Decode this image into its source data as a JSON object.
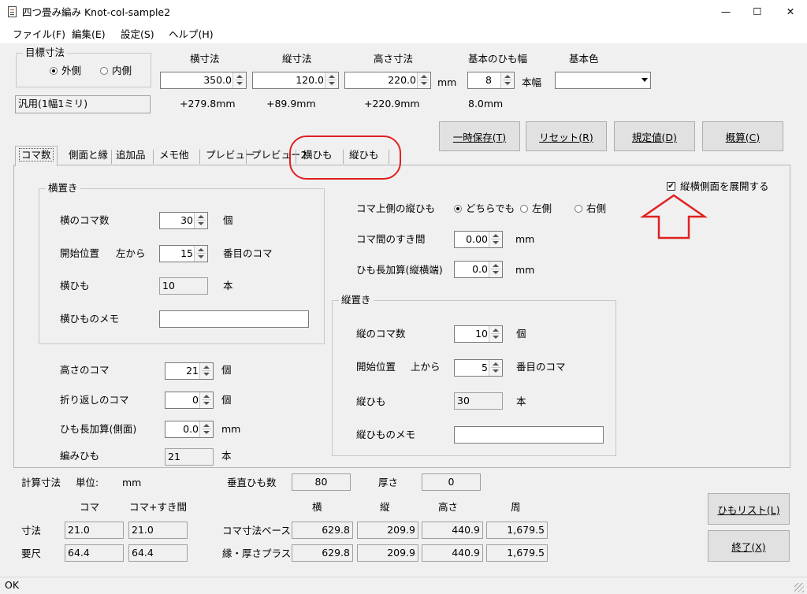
{
  "window": {
    "title": "四つ畳み編み Knot-col-sample2",
    "minimize": "—",
    "maximize": "☐",
    "close": "✕"
  },
  "menu": [
    {
      "label": "ファイル(F)"
    },
    {
      "label": "編集(E)"
    },
    {
      "label": "設定(S)"
    },
    {
      "label": "ヘルプ(H)"
    }
  ],
  "target": {
    "group_title": "目標寸法",
    "outer": "外側",
    "inner": "内側",
    "width_label": "横寸法",
    "depth_label": "縦寸法",
    "height_label": "高さ寸法",
    "band_label": "基本のひも幅",
    "color_label": "基本色",
    "width_value": "350.0",
    "depth_value": "120.0",
    "height_value": "220.0",
    "mm": "mm",
    "band_value": "8",
    "band_unit": "本幅",
    "color_value": "",
    "calc_width": "+279.8mm",
    "calc_depth": "+89.9mm",
    "calc_height": "+220.9mm",
    "calc_band": "8.0mm",
    "preset": "汎用(1幅1ミリ)"
  },
  "actions": {
    "save": "一時保存(T)",
    "reset": "リセット(R)",
    "default": "規定値(D)",
    "estimate": "概算(C)"
  },
  "tabs": [
    {
      "label": "コマ数"
    },
    {
      "label": "側面と縁"
    },
    {
      "label": "追加品"
    },
    {
      "label": "メモ他"
    },
    {
      "label": "プレビュー"
    },
    {
      "label": "プレビュー2"
    },
    {
      "label": "横ひも"
    },
    {
      "label": "縦ひも"
    }
  ],
  "expand_checkbox": "縦横側面を展開する",
  "horizontal": {
    "title": "横置き",
    "count_label": "横のコマ数",
    "count_value": "30",
    "count_unit": "個",
    "start_label": "開始位置",
    "start_dir": "左から",
    "start_value": "15",
    "start_unit": "番目のコマ",
    "band_label": "横ひも",
    "band_value": "10",
    "band_unit": "本",
    "memo_label": "横ひものメモ",
    "memo_value": ""
  },
  "top_side": {
    "label": "コマ上側の縦ひも",
    "either": "どちらでも",
    "left": "左側",
    "right": "右側",
    "gap_label": "コマ間のすき間",
    "gap_value": "0.00",
    "gap_unit": "mm",
    "extra_label": "ひも長加算(縦横端)",
    "extra_value": "0.0",
    "extra_unit": "mm"
  },
  "vertical": {
    "title": "縦置き",
    "count_label": "縦のコマ数",
    "count_value": "10",
    "count_unit": "個",
    "start_label": "開始位置",
    "start_dir": "上から",
    "start_value": "5",
    "start_unit": "番目のコマ",
    "band_label": "縦ひも",
    "band_value": "30",
    "band_unit": "本",
    "memo_label": "縦ひものメモ",
    "memo_value": ""
  },
  "lower": {
    "height_label": "高さのコマ",
    "height_value": "21",
    "height_unit": "個",
    "fold_label": "折り返しのコマ",
    "fold_value": "0",
    "fold_unit": "個",
    "extra_label": "ひも長加算(側面)",
    "extra_value": "0.0",
    "extra_unit": "mm",
    "weave_label": "編みひも",
    "weave_value": "21",
    "weave_unit": "本"
  },
  "calc": {
    "title": "計算寸法",
    "unit_label": "単位:",
    "unit": "mm",
    "vertical_count_label": "垂直ひも数",
    "vertical_count": "80",
    "thickness_label": "厚さ",
    "thickness": "0",
    "koma_header": "コマ",
    "koma_gap_header": "コマ+すき間",
    "col_w": "横",
    "col_d": "縦",
    "col_h": "高さ",
    "col_p": "周",
    "size_label": "寸法",
    "size_koma": "21.0",
    "size_koma_gap": "21.0",
    "scale_label": "要尺",
    "scale_koma": "64.4",
    "scale_koma_gap": "64.4",
    "base_label": "コマ寸法ベース",
    "base_w": "629.8",
    "base_d": "209.9",
    "base_h": "440.9",
    "base_p": "1,679.5",
    "plus_label": "縁・厚さプラス",
    "plus_w": "629.8",
    "plus_d": "209.9",
    "plus_h": "440.9",
    "plus_p": "1,679.5"
  },
  "bottom_buttons": {
    "band_list": "ひもリスト(L)",
    "exit": "終了(X)"
  },
  "status": "OK",
  "annotation_color": "#e02020"
}
